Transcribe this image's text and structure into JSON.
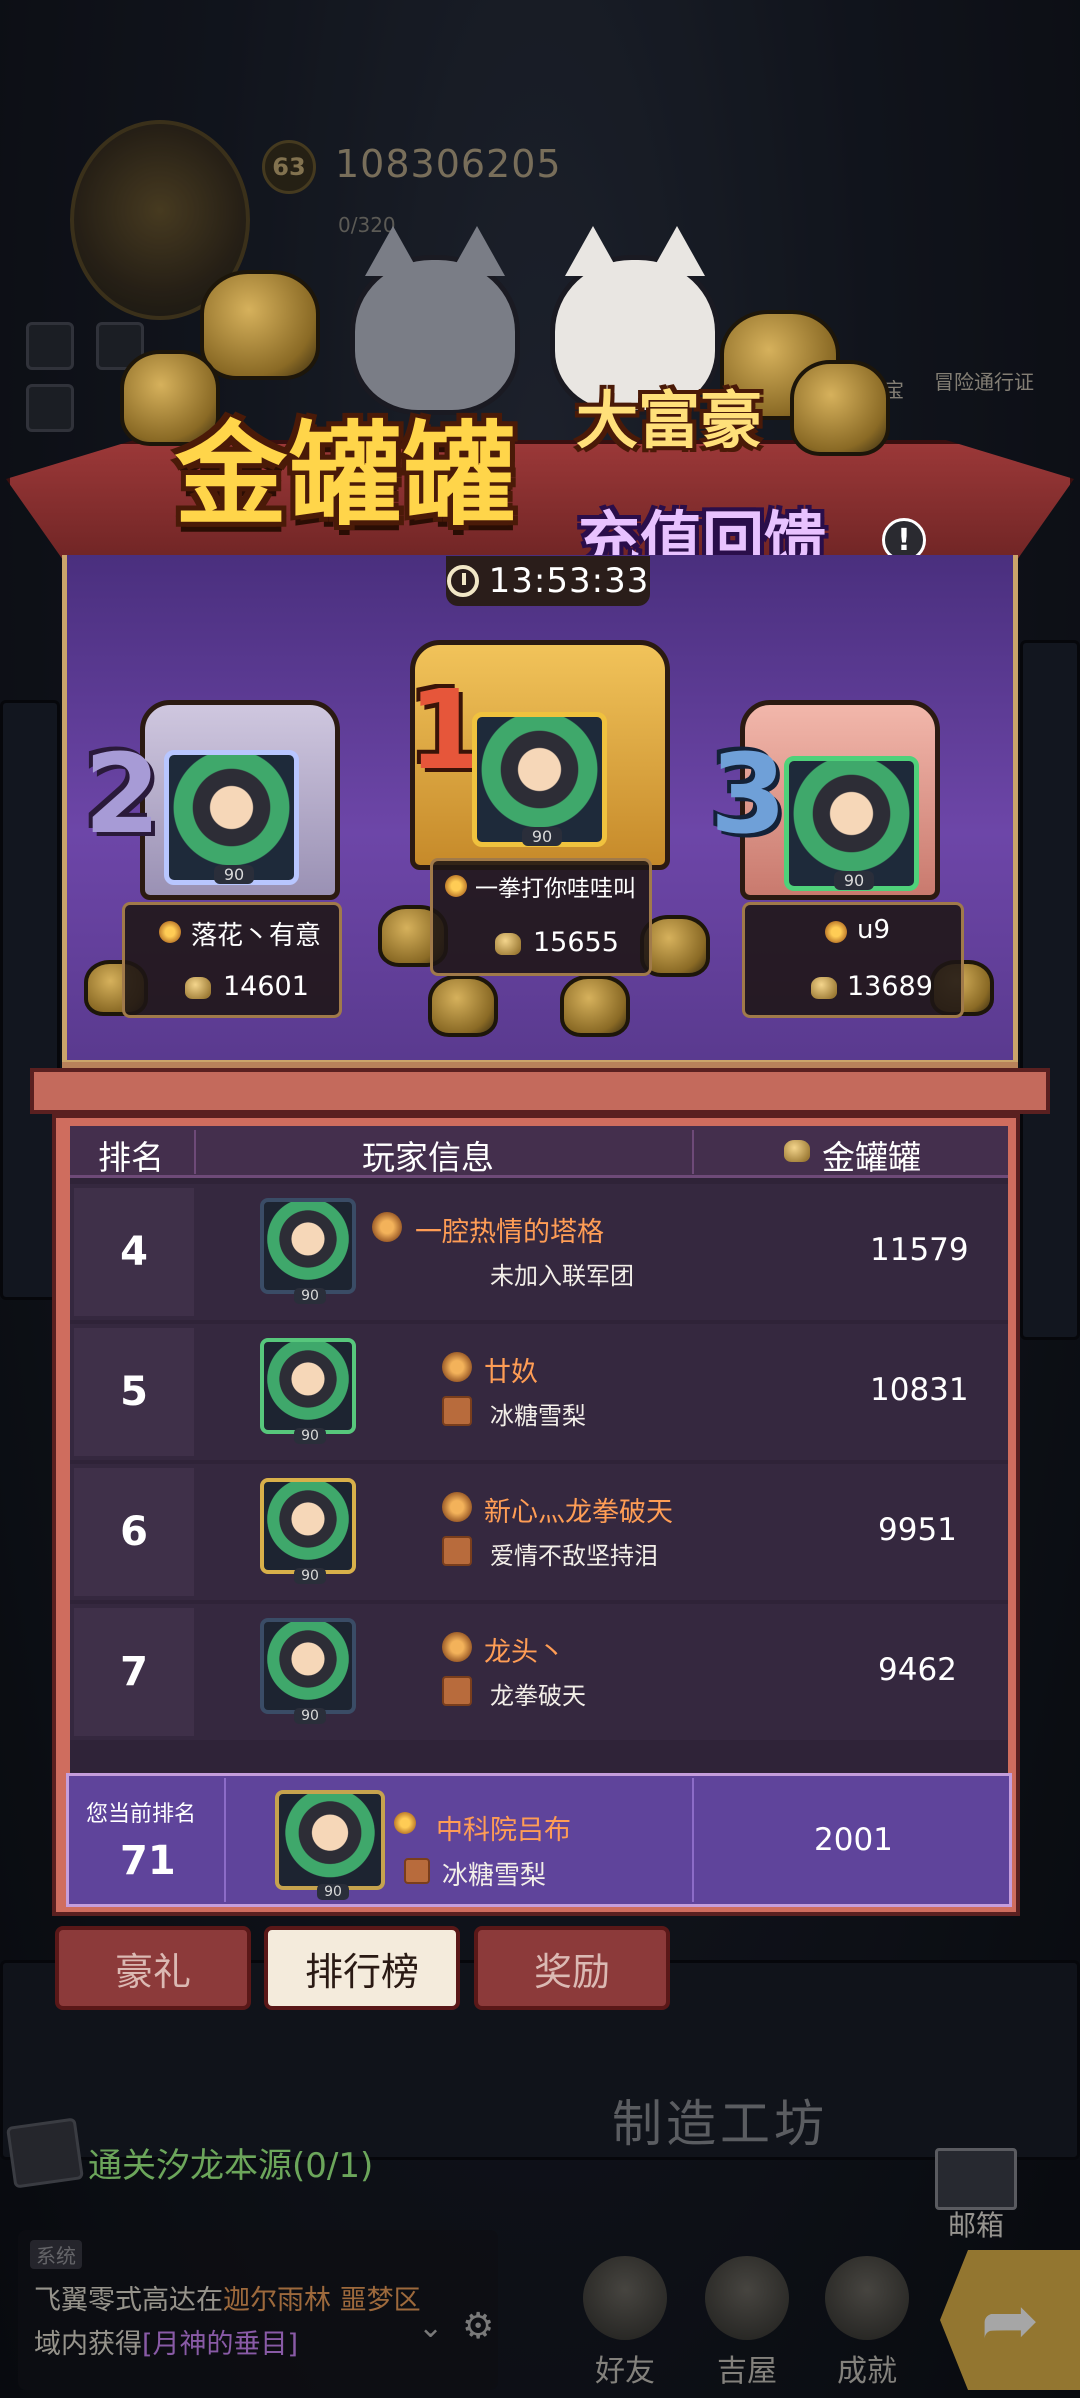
{
  "hud": {
    "level": "63",
    "power": "108306205",
    "energy": "0/320",
    "right_labels": [
      "宝",
      "冒险通行证"
    ]
  },
  "event": {
    "title_main": "金罐罐",
    "title_sub1": "大富豪",
    "title_sub2": "充值回馈",
    "info_icon": "!",
    "timer": "13:53:33"
  },
  "podium": [
    {
      "rank": "2",
      "name": "落花丶有意",
      "score": "14601",
      "level": "90"
    },
    {
      "rank": "1",
      "name": "一拳打你哇哇叫",
      "score": "15655",
      "level": "90"
    },
    {
      "rank": "3",
      "name": "u9",
      "score": "13689",
      "level": "90"
    }
  ],
  "board": {
    "col_rank": "排名",
    "col_player": "玩家信息",
    "col_score": "金罐罐",
    "rows": [
      {
        "rank": "4",
        "name": "一腔热情的塔格",
        "guild": "未加入联军团",
        "score": "11579",
        "level": "90"
      },
      {
        "rank": "5",
        "name": "廿奺",
        "guild": "冰糖雪梨",
        "score": "10831",
        "level": "90"
      },
      {
        "rank": "6",
        "name": "新心灬龙拳破天",
        "guild": "爱情不敌坚持泪",
        "score": "9951",
        "level": "90"
      },
      {
        "rank": "7",
        "name": "龙头丶",
        "guild": "龙拳破天",
        "score": "9462",
        "level": "90"
      }
    ],
    "me": {
      "label": "您当前排名",
      "rank": "71",
      "name": "中科院吕布",
      "guild": "冰糖雪梨",
      "score": "2001",
      "level": "90"
    }
  },
  "tabs": {
    "gift": "豪礼",
    "ranking": "排行榜",
    "reward": "奖励"
  },
  "bottom": {
    "task": "通关汐龙本源(0/1)",
    "workshop": "制造工坊",
    "mail": "邮箱",
    "chat_tag": "系统",
    "chat_line1_a": "飞翼零式高达在",
    "chat_line1_b": "迦尔雨林 噩梦区",
    "chat_line2_a": "域内获得",
    "chat_line2_b": "[月神的垂目]",
    "nav": [
      "好友",
      "吉屋",
      "成就"
    ]
  }
}
